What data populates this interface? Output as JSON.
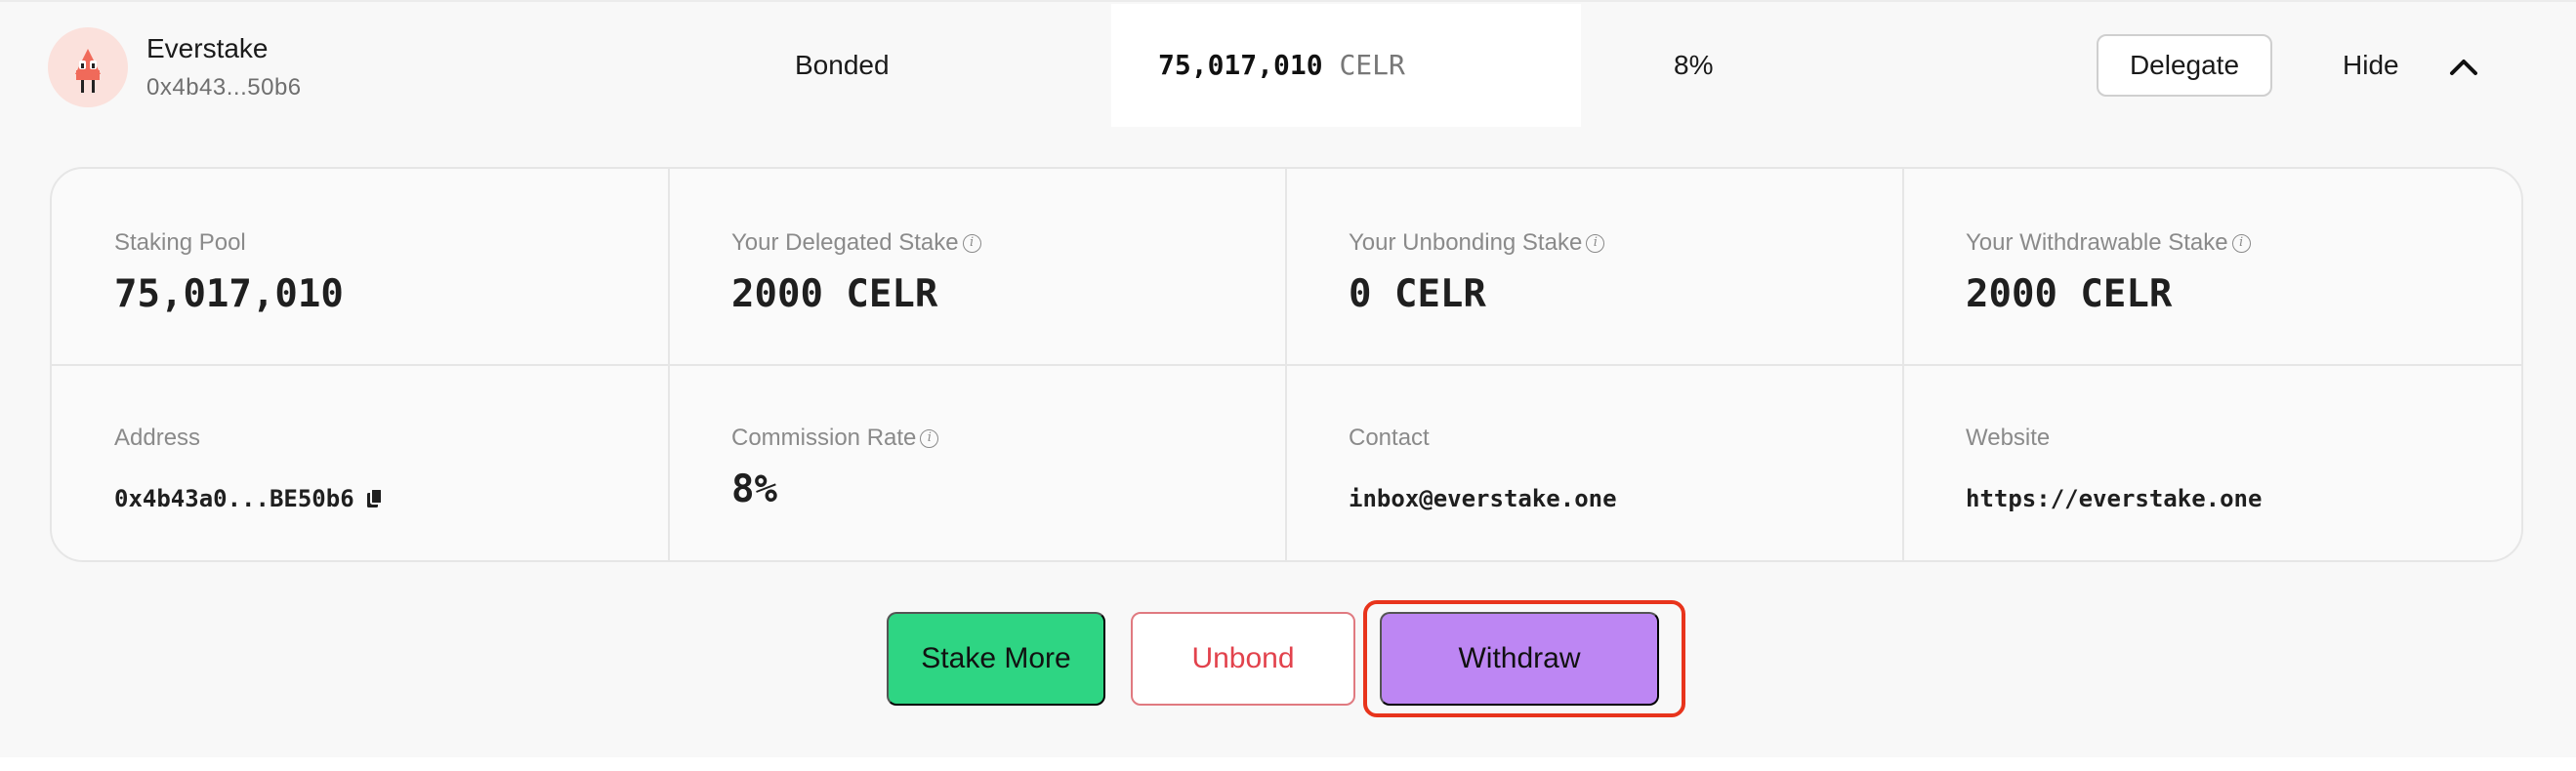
{
  "validator": {
    "name": "Everstake",
    "address_short": "0x4b43...50b6",
    "status": "Bonded",
    "stake_amount": "75,017,010",
    "stake_unit": "CELR",
    "commission": "8%",
    "delegate_label": "Delegate",
    "hide_label": "Hide",
    "avatar_icon": "everstake-logo-icon",
    "avatar_bg": "#fbe1dc"
  },
  "details": {
    "staking_pool": {
      "label": "Staking Pool",
      "value": "75,017,010"
    },
    "delegated": {
      "label": "Your Delegated Stake",
      "value": "2000 CELR"
    },
    "unbonding": {
      "label": "Your Unbonding Stake",
      "value": "0 CELR"
    },
    "withdrawable": {
      "label": "Your Withdrawable Stake",
      "value": "2000 CELR"
    },
    "address": {
      "label": "Address",
      "value": "0x4b43a0...BE50b6"
    },
    "commission_rate": {
      "label": "Commission Rate",
      "value": "8%"
    },
    "contact": {
      "label": "Contact",
      "value": "inbox@everstake.one"
    },
    "website": {
      "label": "Website",
      "value": "https://everstake.one"
    }
  },
  "actions": {
    "stake_more": "Stake More",
    "unbond": "Unbond",
    "withdraw": "Withdraw"
  },
  "colors": {
    "stake_more_bg": "#2ed583",
    "unbond_text": "#e2424c",
    "withdraw_bg": "#bd86f3",
    "highlight": "#e8341c"
  }
}
